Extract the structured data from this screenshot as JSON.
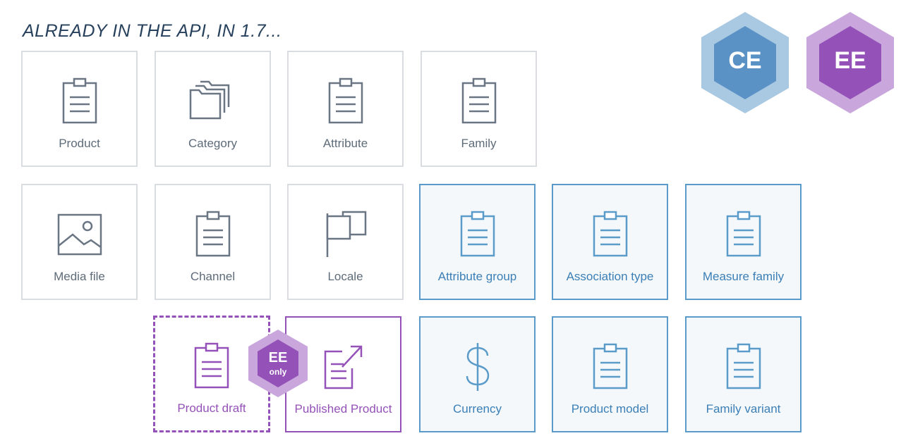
{
  "title": "ALREADY IN THE API, IN 1.7...",
  "badges": {
    "ce": "CE",
    "ee": "EE",
    "ee_only_top": "EE",
    "ee_only_bottom": "only"
  },
  "cards": {
    "product": "Product",
    "category": "Category",
    "attribute": "Attribute",
    "family": "Family",
    "media_file": "Media file",
    "channel": "Channel",
    "locale": "Locale",
    "attribute_group": "Attribute group",
    "association_type": "Association type",
    "measure_family": "Measure family",
    "product_draft": "Product draft",
    "published_product": "Published Product",
    "currency": "Currency",
    "product_model": "Product model",
    "family_variant": "Family variant"
  },
  "colors": {
    "gray": "#6a7684",
    "blue": "#5a9bc9",
    "purple": "#9452b8",
    "ce_outer": "#a9c8e2",
    "ce_inner": "#5a92c6",
    "ee_outer": "#c9a6dc",
    "ee_inner": "#9452b8"
  }
}
